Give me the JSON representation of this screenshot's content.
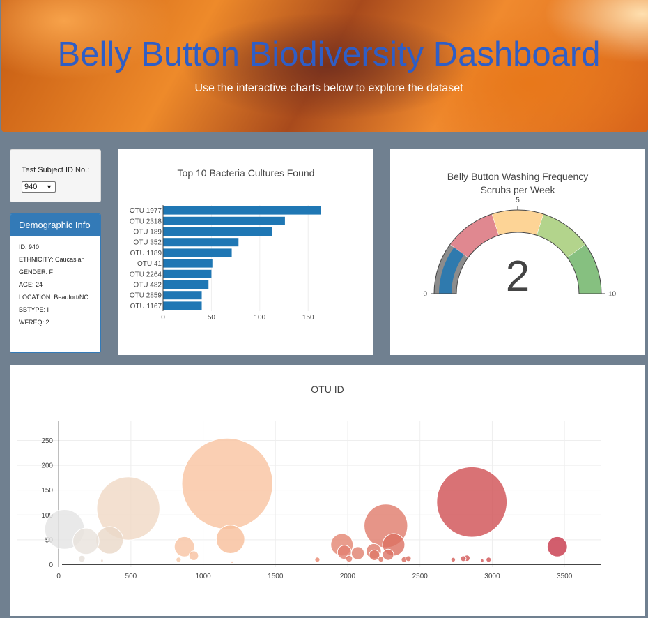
{
  "header": {
    "title": "Belly Button Biodiversity Dashboard",
    "subtitle": "Use the interactive charts below to explore the dataset"
  },
  "selector": {
    "label": "Test Subject ID No.:",
    "selected": "940"
  },
  "demographics": {
    "title": "Demographic Info",
    "rows": [
      "ID: 940",
      "ETHNICITY: Caucasian",
      "GENDER: F",
      "AGE: 24",
      "LOCATION: Beaufort/NC",
      "BBTYPE: I",
      "WFREQ: 2"
    ]
  },
  "colors": {
    "bar": "#1f77b4",
    "page_bg": "#708090",
    "panel_header": "#337ab7",
    "title_blue": "#2f5ec6"
  },
  "chart_data": [
    {
      "type": "bar",
      "orientation": "horizontal",
      "title": "Top 10 Bacteria Cultures Found",
      "categories": [
        "OTU 1977",
        "OTU 2318",
        "OTU 189",
        "OTU 352",
        "OTU 1189",
        "OTU 41",
        "OTU 2264",
        "OTU 482",
        "OTU 2859",
        "OTU 1167"
      ],
      "values": [
        163,
        126,
        113,
        78,
        71,
        51,
        50,
        47,
        40,
        40
      ],
      "xlim": [
        0,
        170
      ],
      "xticks": [
        0,
        50,
        100,
        150
      ]
    },
    {
      "type": "gauge",
      "title": "Belly Button Washing Frequency",
      "subtitle": "Scrubs per Week",
      "value": 2,
      "range": [
        0,
        10
      ],
      "ticks": [
        0,
        5,
        10
      ],
      "bands": [
        {
          "from": 0,
          "to": 2,
          "color": "#8c8c8c"
        },
        {
          "from": 2,
          "to": 4,
          "color": "#e08890"
        },
        {
          "from": 4,
          "to": 6,
          "color": "#fdd496"
        },
        {
          "from": 6,
          "to": 8,
          "color": "#b3d48c"
        },
        {
          "from": 8,
          "to": 10,
          "color": "#86c080"
        }
      ]
    },
    {
      "type": "scatter",
      "title": "OTU ID",
      "xlim": [
        -290,
        3750
      ],
      "ylim": [
        -5,
        290
      ],
      "xticks": [
        0,
        500,
        1000,
        1500,
        2000,
        2500,
        3000,
        3500
      ],
      "yticks": [
        0,
        50,
        100,
        150,
        200,
        250
      ],
      "points": [
        {
          "x": 41,
          "y": 71,
          "size": 71,
          "color": "#e4e4e4"
        },
        {
          "x": 189,
          "y": 47,
          "size": 47,
          "color": "#e8e2dc"
        },
        {
          "x": 160,
          "y": 12,
          "size": 12,
          "color": "#e6e0da"
        },
        {
          "x": 300,
          "y": 8,
          "size": 5,
          "color": "#eadbd0"
        },
        {
          "x": 352,
          "y": 49,
          "size": 49,
          "color": "#ead8c8"
        },
        {
          "x": 482,
          "y": 113,
          "size": 113,
          "color": "#f0d8c4"
        },
        {
          "x": 830,
          "y": 10,
          "size": 9,
          "color": "#f5c8a8"
        },
        {
          "x": 870,
          "y": 36,
          "size": 36,
          "color": "#f7c3a2"
        },
        {
          "x": 935,
          "y": 18,
          "size": 17,
          "color": "#f7c1a0"
        },
        {
          "x": 1167,
          "y": 163,
          "size": 163,
          "color": "#f9c3a0"
        },
        {
          "x": 1189,
          "y": 51,
          "size": 51,
          "color": "#f8be9a"
        },
        {
          "x": 1200,
          "y": 5,
          "size": 4,
          "color": "#f5b896"
        },
        {
          "x": 1790,
          "y": 10,
          "size": 9,
          "color": "#e8866e"
        },
        {
          "x": 1960,
          "y": 40,
          "size": 40,
          "color": "#e48470"
        },
        {
          "x": 1977,
          "y": 25,
          "size": 25,
          "color": "#e28070"
        },
        {
          "x": 2010,
          "y": 12,
          "size": 12,
          "color": "#e27c6c"
        },
        {
          "x": 2070,
          "y": 23,
          "size": 23,
          "color": "#e0806e"
        },
        {
          "x": 2180,
          "y": 27,
          "size": 27,
          "color": "#df7a6a"
        },
        {
          "x": 2185,
          "y": 19,
          "size": 19,
          "color": "#de7868"
        },
        {
          "x": 2230,
          "y": 11,
          "size": 10,
          "color": "#dc7464"
        },
        {
          "x": 2264,
          "y": 78,
          "size": 78,
          "color": "#e07a6a"
        },
        {
          "x": 2280,
          "y": 20,
          "size": 20,
          "color": "#dc7466"
        },
        {
          "x": 2318,
          "y": 40,
          "size": 40,
          "color": "#dc7062"
        },
        {
          "x": 2390,
          "y": 10,
          "size": 10,
          "color": "#d86a5e"
        },
        {
          "x": 2420,
          "y": 12,
          "size": 10,
          "color": "#d86a5e"
        },
        {
          "x": 2730,
          "y": 10,
          "size": 8,
          "color": "#d45c58"
        },
        {
          "x": 2800,
          "y": 12,
          "size": 10,
          "color": "#d25858"
        },
        {
          "x": 2825,
          "y": 13,
          "size": 11,
          "color": "#d15656"
        },
        {
          "x": 2859,
          "y": 126,
          "size": 126,
          "color": "#d04f52"
        },
        {
          "x": 2930,
          "y": 8,
          "size": 6,
          "color": "#d15456"
        },
        {
          "x": 2975,
          "y": 10,
          "size": 9,
          "color": "#d05254"
        },
        {
          "x": 3450,
          "y": 36,
          "size": 36,
          "color": "#c73648"
        }
      ]
    }
  ]
}
